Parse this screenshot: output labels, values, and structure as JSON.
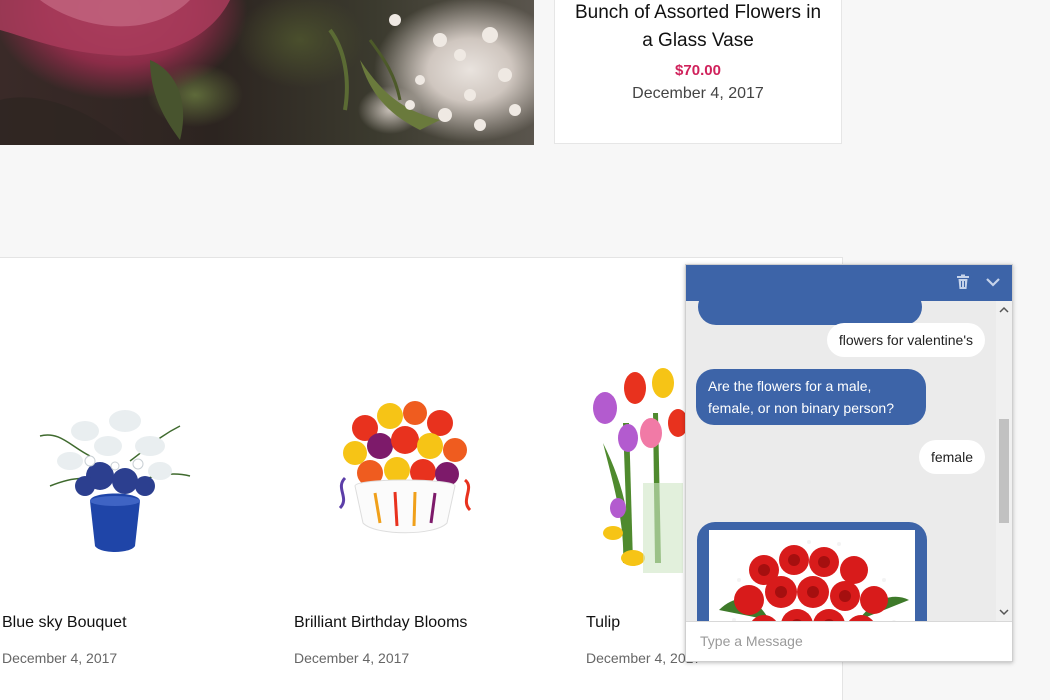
{
  "featured": {
    "title": "Bunch of Assorted Flowers in a Glass Vase",
    "price": "$70.00",
    "date": "December 4, 2017"
  },
  "products": [
    {
      "name": "Blue sky Bouquet",
      "date": "December 4, 2017"
    },
    {
      "name": "Brilliant Birthday Blooms",
      "date": "December 4, 2017"
    },
    {
      "name": "Tulip",
      "date": "December 4, 2017"
    }
  ],
  "chat": {
    "messages": [
      {
        "from": "user",
        "text": "flowers for valentine's"
      },
      {
        "from": "bot",
        "text": "Are the flowers for a male, female, or non binary person?"
      },
      {
        "from": "user",
        "text": "female"
      }
    ],
    "input_placeholder": "Type a Message",
    "icons": {
      "clear": "trash-icon",
      "minimize": "chevron-down-icon"
    },
    "colors": {
      "header": "#3d64a8",
      "bot_bubble": "#3d64a8",
      "price": "#d0215b"
    }
  }
}
